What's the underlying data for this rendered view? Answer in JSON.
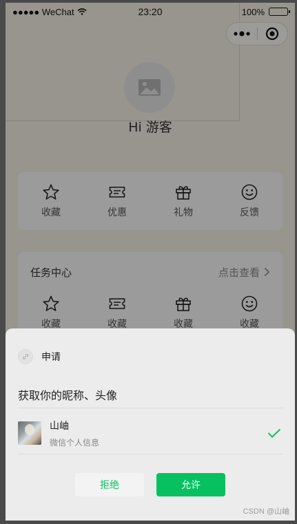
{
  "status_bar": {
    "carrier": "●●●●● WeChat",
    "time": "23:20",
    "battery": "100%"
  },
  "page": {
    "greeting": "Hi 游客",
    "quick_actions": [
      {
        "label": "收藏",
        "icon": "star-icon"
      },
      {
        "label": "优惠",
        "icon": "ticket-icon"
      },
      {
        "label": "礼物",
        "icon": "gift-icon"
      },
      {
        "label": "反馈",
        "icon": "smiley-icon"
      }
    ],
    "tasks": {
      "title": "任务中心",
      "more": "点击查看",
      "items": [
        {
          "label": "收藏",
          "icon": "star-icon"
        },
        {
          "label": "收藏",
          "icon": "ticket-icon"
        },
        {
          "label": "收藏",
          "icon": "gift-icon"
        },
        {
          "label": "收藏",
          "icon": "smiley-icon"
        }
      ]
    }
  },
  "sheet": {
    "title": "申请",
    "description": "获取你的昵称、头像",
    "profile_name": "山岫",
    "profile_sub": "微信个人信息",
    "reject_label": "拒绝",
    "allow_label": "允许"
  },
  "watermark": "CSDN @山岫",
  "colors": {
    "accent": "#07c160",
    "sheet_bg": "#ececec",
    "page_bg": "#f6f0e6"
  }
}
